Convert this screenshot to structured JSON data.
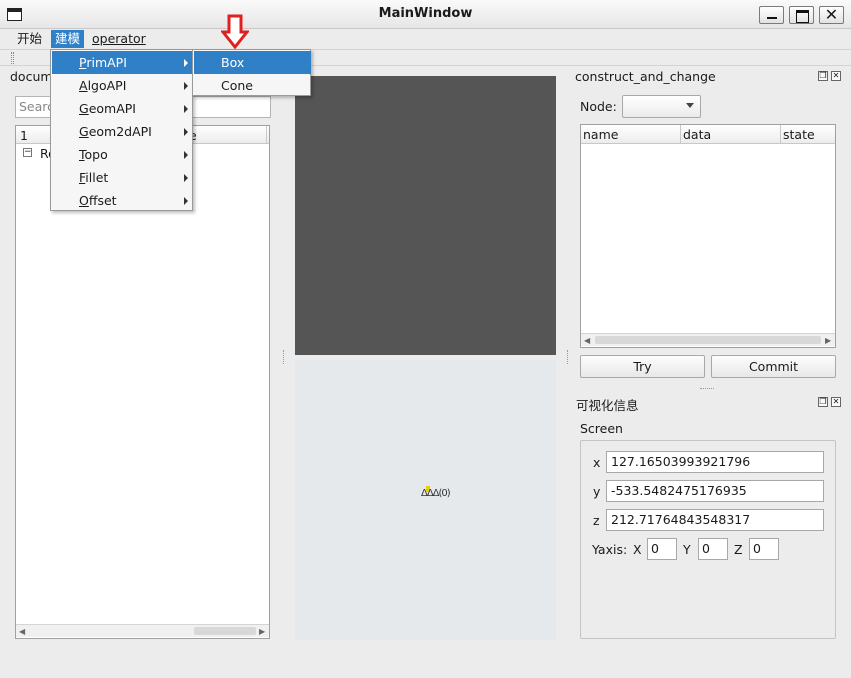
{
  "window": {
    "title": "MainWindow"
  },
  "menubar": {
    "items": [
      "开始",
      "建模",
      "operator"
    ]
  },
  "model_menu": {
    "items": [
      {
        "label": "PrimAPI",
        "hot": "P",
        "rest": "rimAPI"
      },
      {
        "label": "AlgoAPI",
        "hot": "A",
        "rest": "lgoAPI"
      },
      {
        "label": "GeomAPI",
        "hot": "G",
        "rest": "eomAPI"
      },
      {
        "label": "Geom2dAPI",
        "hot": "G",
        "rest": "eom2dAPI"
      },
      {
        "label": "Topo",
        "hot": "T",
        "rest": "opo"
      },
      {
        "label": "Fillet",
        "hot": "F",
        "rest": "illet"
      },
      {
        "label": "Offset",
        "hot": "O",
        "rest": "ffset"
      }
    ],
    "submenu": [
      "Box",
      "Cone"
    ]
  },
  "left_dock": {
    "title": "docum",
    "search_placeholder": "Searc",
    "tree_header": [
      "1",
      "e"
    ],
    "tree_root": "Ro"
  },
  "right_dock": {
    "title": "construct_and_change",
    "node_label": "Node:",
    "columns": [
      "name",
      "data",
      "state"
    ],
    "try_label": "Try",
    "commit_label": "Commit"
  },
  "vis_dock": {
    "title": "可视化信息",
    "screen_label": "Screen",
    "x_label": "x",
    "x_value": "127.16503993921796",
    "y_label": "y",
    "y_value": "-533.5482475176935",
    "z_label": "z",
    "z_value": "212.71764843548317",
    "yaxis_label": "Yaxis:",
    "axis_x_label": "X",
    "axis_x_value": "0",
    "axis_y_label": "Y",
    "axis_y_value": "0",
    "axis_z_label": "Z",
    "axis_z_value": "0"
  },
  "viewer": {
    "axis_text": "ΔΔΔ(0)"
  },
  "colors": {
    "highlight": "#3080c8",
    "viewer_dark": "#555555",
    "viewer_light": "#e5e9ec",
    "pointer": "#e02020"
  }
}
